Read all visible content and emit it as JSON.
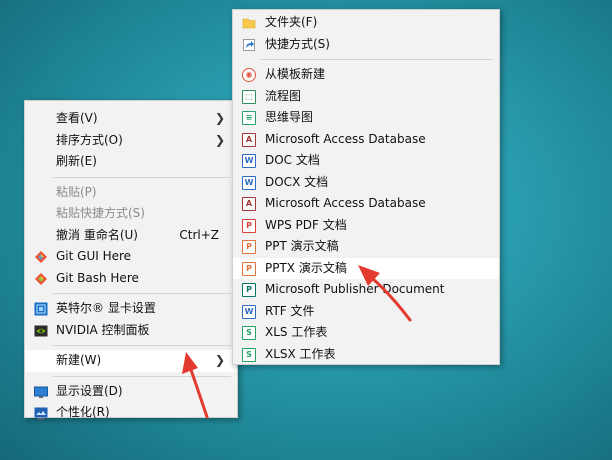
{
  "context_menu": {
    "items": [
      {
        "label": "查看(V)"
      },
      {
        "label": "排序方式(O)"
      },
      {
        "label": "刷新(E)"
      },
      {
        "label": "粘贴(P)"
      },
      {
        "label": "粘贴快捷方式(S)"
      },
      {
        "label": "撤消 重命名(U)",
        "shortcut": "Ctrl+Z"
      },
      {
        "label": "Git GUI Here",
        "icon": "git-gui-icon"
      },
      {
        "label": "Git Bash Here",
        "icon": "git-bash-icon"
      },
      {
        "label": "英特尔® 显卡设置",
        "icon": "intel-graphics-icon"
      },
      {
        "label": "NVIDIA 控制面板",
        "icon": "nvidia-icon"
      },
      {
        "label": "新建(W)"
      },
      {
        "label": "显示设置(D)",
        "icon": "display-icon"
      },
      {
        "label": "个性化(R)",
        "icon": "personalize-icon"
      }
    ]
  },
  "new_submenu": {
    "items": [
      {
        "label": "文件夹(F)",
        "icon": "folder-icon"
      },
      {
        "label": "快捷方式(S)",
        "icon": "shortcut-icon"
      },
      {
        "label": "从模板新建",
        "icon": "template-icon"
      },
      {
        "label": "流程图",
        "icon": "flowchart-icon"
      },
      {
        "label": "思维导图",
        "icon": "mindmap-icon"
      },
      {
        "label": "Microsoft Access Database",
        "icon": "access-icon"
      },
      {
        "label": "DOC 文档",
        "icon": "doc-icon"
      },
      {
        "label": "DOCX 文档",
        "icon": "docx-icon"
      },
      {
        "label": "Microsoft Access Database",
        "icon": "access-icon"
      },
      {
        "label": "WPS PDF 文档",
        "icon": "pdf-icon"
      },
      {
        "label": "PPT 演示文稿",
        "icon": "ppt-icon"
      },
      {
        "label": "PPTX 演示文稿",
        "icon": "pptx-icon"
      },
      {
        "label": "Microsoft Publisher Document",
        "icon": "publisher-icon"
      },
      {
        "label": "RTF 文件",
        "icon": "rtf-icon"
      },
      {
        "label": "XLS 工作表",
        "icon": "xls-icon"
      },
      {
        "label": "XLSX 工作表",
        "icon": "xlsx-icon"
      }
    ]
  },
  "colors": {
    "annotation_arrow": "#e23a2e",
    "menu_background": "#f2f2f2",
    "highlight": "#ffffff"
  }
}
